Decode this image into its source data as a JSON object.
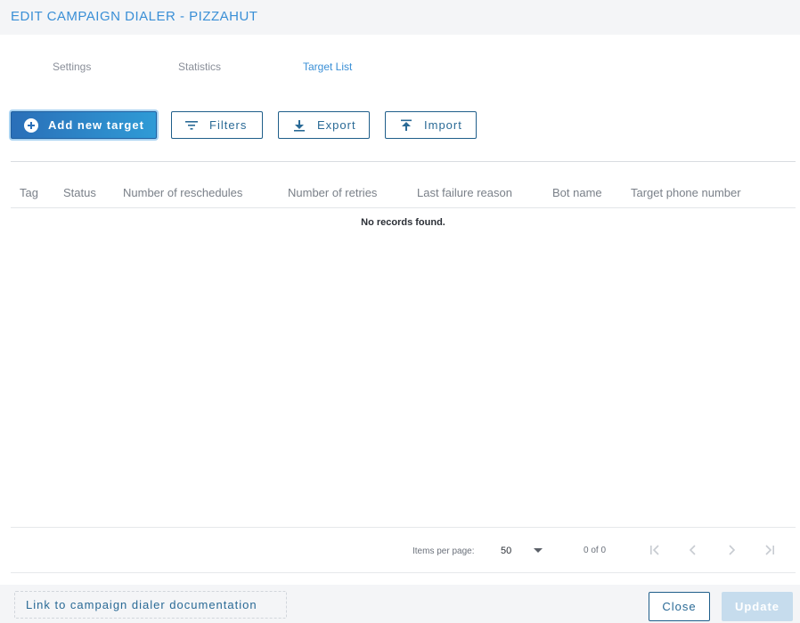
{
  "header": {
    "title": "EDIT CAMPAIGN DIALER - PIZZAHUT"
  },
  "tabs": [
    {
      "label": "Settings",
      "active": false
    },
    {
      "label": "Statistics",
      "active": false
    },
    {
      "label": "Target List",
      "active": true
    }
  ],
  "toolbar": {
    "add_label": "Add new target",
    "filters_label": "Filters",
    "export_label": "Export",
    "import_label": "Import"
  },
  "table": {
    "columns": [
      "Tag",
      "Status",
      "Number of reschedules",
      "Number of retries",
      "Last failure reason",
      "Bot name",
      "Target phone number"
    ],
    "empty_message": "No records found."
  },
  "pagination": {
    "items_per_page_label": "Items per page:",
    "items_per_page_value": "50",
    "range": "0 of 0"
  },
  "footer": {
    "doc_link": "Link to campaign dialer documentation",
    "close_label": "Close",
    "update_label": "Update"
  },
  "colors": {
    "accent": "#3a8fd6",
    "primary_button": "#2a6fb8",
    "outline": "#1f5e8a",
    "disabled": "#c6dced"
  },
  "icons": [
    "plus-circle-icon",
    "filter-icon",
    "download-icon",
    "upload-icon",
    "first-page-icon",
    "prev-page-icon",
    "next-page-icon",
    "last-page-icon",
    "chevron-down-icon"
  ]
}
